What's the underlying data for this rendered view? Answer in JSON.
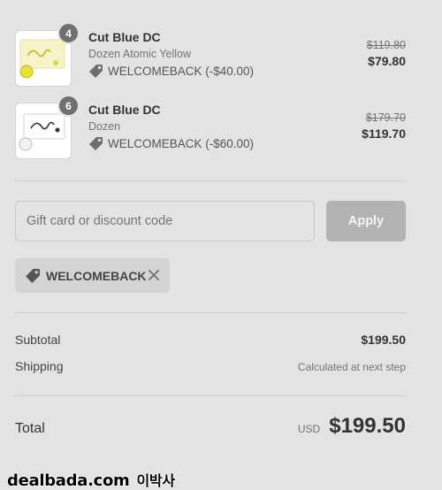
{
  "items": [
    {
      "quantity": "4",
      "name": "Cut Blue DC",
      "variant": "Dozen Atomic Yellow",
      "discount": "WELCOMEBACK (-$40.00)",
      "original_price": "$119.80",
      "price": "$79.80",
      "image_icon": "product-yellow-balls-icon"
    },
    {
      "quantity": "6",
      "name": "Cut Blue DC",
      "variant": "Dozen",
      "discount": "WELCOMEBACK (-$60.00)",
      "original_price": "$179.70",
      "price": "$119.70",
      "image_icon": "product-white-balls-icon"
    }
  ],
  "discount_form": {
    "placeholder": "Gift card or discount code",
    "value": "",
    "apply_label": "Apply"
  },
  "applied_code": {
    "code": "WELCOMEBACK"
  },
  "summary": {
    "subtotal_label": "Subtotal",
    "subtotal_value": "$199.50",
    "shipping_label": "Shipping",
    "shipping_value": "Calculated at next step",
    "total_label": "Total",
    "currency": "USD",
    "total_value": "$199.50"
  },
  "watermark": {
    "site": "dealbada.com",
    "name": "이박사"
  },
  "colors": {
    "background": "#e3e3e3",
    "apply_button": "#b3b3b3",
    "badge": "#707070",
    "code_tag": "#d4d4d4"
  }
}
